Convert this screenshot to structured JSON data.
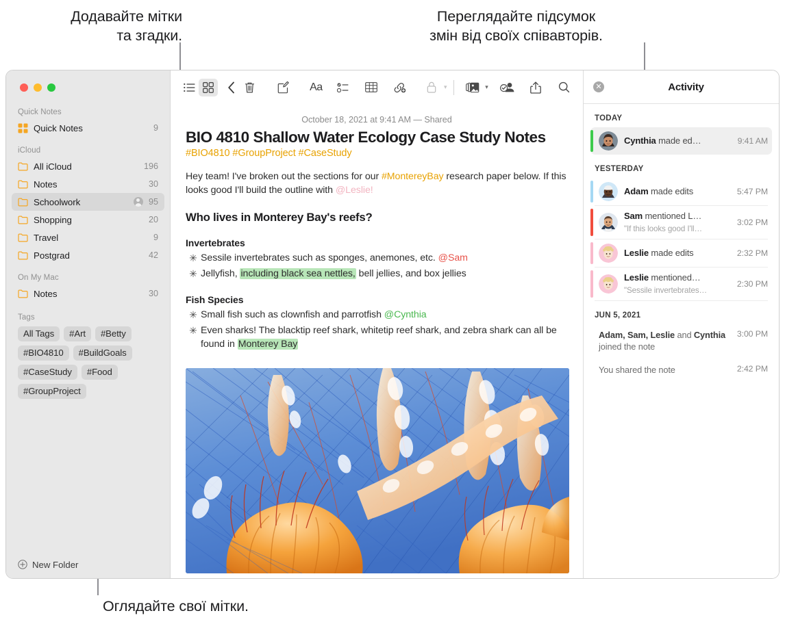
{
  "callouts": {
    "tags": "Додавайте мітки\nта згадки.",
    "activity": "Переглядайте підсумок\nзмін від своїх співавторів.",
    "browse": "Оглядайте свої мітки."
  },
  "sidebar": {
    "sections": [
      {
        "title": "Quick Notes",
        "items": [
          {
            "label": "Quick Notes",
            "count": "9",
            "icon": "quicknotes-icon",
            "shared": false,
            "selected": false
          }
        ]
      },
      {
        "title": "iCloud",
        "items": [
          {
            "label": "All iCloud",
            "count": "196",
            "icon": "folder-icon",
            "shared": false,
            "selected": false
          },
          {
            "label": "Notes",
            "count": "30",
            "icon": "folder-icon",
            "shared": false,
            "selected": false
          },
          {
            "label": "Schoolwork",
            "count": "95",
            "icon": "folder-icon",
            "shared": true,
            "selected": true
          },
          {
            "label": "Shopping",
            "count": "20",
            "icon": "folder-icon",
            "shared": false,
            "selected": false
          },
          {
            "label": "Travel",
            "count": "9",
            "icon": "folder-icon",
            "shared": false,
            "selected": false
          },
          {
            "label": "Postgrad",
            "count": "42",
            "icon": "folder-icon",
            "shared": false,
            "selected": false
          }
        ]
      },
      {
        "title": "On My Mac",
        "items": [
          {
            "label": "Notes",
            "count": "30",
            "icon": "folder-icon",
            "shared": false,
            "selected": false
          }
        ]
      }
    ],
    "tags_title": "Tags",
    "tags": [
      "All Tags",
      "#Art",
      "#Betty",
      "#BIO4810",
      "#BuildGoals",
      "#CaseStudy",
      "#Food",
      "#GroupProject"
    ],
    "new_folder_label": "New Folder"
  },
  "toolbar": {
    "buttons": [
      {
        "name": "list-view-icon",
        "label": "List View"
      },
      {
        "name": "gallery-view-icon",
        "label": "Gallery View"
      },
      {
        "name": "back-chevron-icon",
        "label": "Back"
      },
      {
        "name": "trash-icon",
        "label": "Delete"
      },
      {
        "name": "compose-icon",
        "label": "New Note"
      },
      {
        "name": "format-aa-icon",
        "label": "Aa"
      },
      {
        "name": "checklist-icon",
        "label": "Checklist"
      },
      {
        "name": "table-icon",
        "label": "Table"
      },
      {
        "name": "link-add-icon",
        "label": "Add Link"
      },
      {
        "name": "lock-icon",
        "label": "Lock Note"
      },
      {
        "name": "media-icon",
        "label": "Media"
      },
      {
        "name": "share-collab-icon",
        "label": "Collaborate"
      },
      {
        "name": "share-icon",
        "label": "Share"
      },
      {
        "name": "search-icon",
        "label": "Search"
      }
    ],
    "format_label": "Aa"
  },
  "note": {
    "date": "October 18, 2021 at 9:41 AM — Shared",
    "title": "BIO 4810 Shallow Water Ecology Case Study Notes",
    "tags": "#BIO4810 #GroupProject #CaseStudy",
    "intro": {
      "part1": "Hey team! I've broken out the sections for our ",
      "mention1": "#MontereyBay",
      "part2": " research paper below. If this looks good I'll build the outline with ",
      "mention2": "@Leslie!"
    },
    "heading": "Who lives in Monterey Bay's reefs?",
    "sections": [
      {
        "heading": "Invertebrates",
        "bullets": [
          {
            "pre": "Sessile invertebrates such as sponges, anemones, etc. ",
            "mention": "@Sam",
            "mention_color": "red",
            "post": ""
          },
          {
            "pre": "Jellyfish, ",
            "highlight": "including black sea nettles,",
            "post": " bell jellies, and box jellies"
          }
        ]
      },
      {
        "heading": "Fish Species",
        "bullets": [
          {
            "pre": "Small fish such as clownfish and parrotfish ",
            "mention": "@Cynthia",
            "mention_color": "green",
            "post": ""
          },
          {
            "pre": "Even sharks! The blacktip reef shark, whitetip reef shark, and zebra shark can all be found in ",
            "highlight": "Monterey Bay",
            "post": ""
          }
        ]
      }
    ],
    "image_alt": "jellyfish-photo"
  },
  "activity": {
    "close_label": "✕",
    "title": "Activity",
    "groups": [
      {
        "day": "TODAY",
        "entries": [
          {
            "actor": "Cynthia",
            "action": " made ed…",
            "quote": "",
            "time": "9:41 AM",
            "bar_color": "#3ecb4c",
            "avatar": "cynthia",
            "selected": true
          }
        ]
      },
      {
        "day": "YESTERDAY",
        "entries": [
          {
            "actor": "Adam",
            "action": " made edits",
            "quote": "",
            "time": "5:47 PM",
            "bar_color": "#a5d8f3",
            "avatar": "adam",
            "selected": false
          },
          {
            "actor": "Sam",
            "action": " mentioned L…",
            "quote": "\"If this looks good I'll…",
            "time": "3:02 PM",
            "bar_color": "#f14d3d",
            "avatar": "sam",
            "selected": false
          },
          {
            "actor": "Leslie",
            "action": " made edits",
            "quote": "",
            "time": "2:32 PM",
            "bar_color": "#f9b9cb",
            "avatar": "leslie",
            "selected": false
          },
          {
            "actor": "Leslie",
            "action": " mentioned…",
            "quote": "\"Sessile invertebrates…",
            "time": "2:30 PM",
            "bar_color": "#f9b9cb",
            "avatar": "leslie",
            "selected": false
          }
        ]
      }
    ],
    "older": {
      "day": "JUN 5, 2021",
      "entries": [
        {
          "names": "Adam, Sam, Leslie",
          "mid": " and ",
          "names2": "Cynthia",
          "tail": " joined the note",
          "time": "3:00 PM"
        },
        {
          "names": "",
          "mid": "",
          "names2": "",
          "tail": "You shared the note",
          "time": "2:42 PM"
        }
      ]
    }
  },
  "colors": {
    "accent_orange": "#e8a202",
    "highlight_green": "#b8e6b8",
    "selected_gray": "#d8d8d8"
  }
}
